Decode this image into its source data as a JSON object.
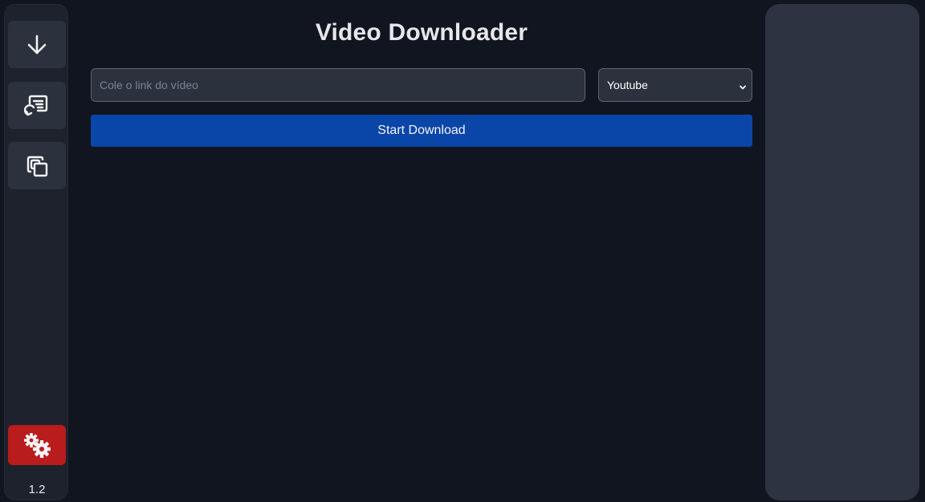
{
  "sidebar": {
    "items": [
      {
        "icon": "download-arrow-icon"
      },
      {
        "icon": "playlist-icon"
      },
      {
        "icon": "copy-icon"
      }
    ],
    "settings": {
      "icon": "gears-icon",
      "color": "#b91c1c"
    },
    "version": "1.2"
  },
  "main": {
    "title": "Video Downloader",
    "url_input": {
      "placeholder": "Cole o link do vídeo",
      "value": ""
    },
    "source_select": {
      "selected": "Youtube"
    },
    "start_button": {
      "label": "Start Download",
      "color": "#0a45a8"
    }
  },
  "colors": {
    "background": "#111520",
    "sidebar": "#1d222c",
    "panel": "#2d3340",
    "text": "#e5e7eb"
  }
}
